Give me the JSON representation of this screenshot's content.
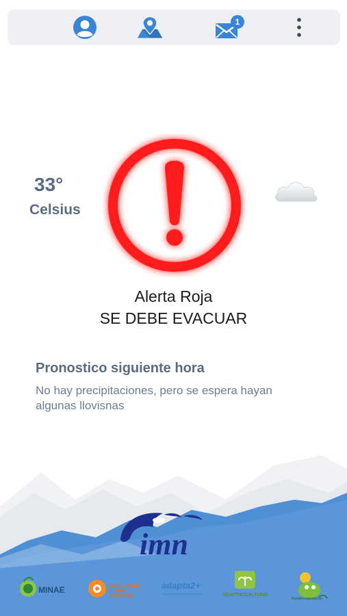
{
  "topbar": {
    "profile_icon": "user-circle-icon",
    "map_icon": "map-pin-icon",
    "messages_icon": "envelope-icon",
    "messages_badge": "1",
    "menu_icon": "more-vert-icon"
  },
  "weather": {
    "temperature": "33°",
    "unit": "Celsius",
    "condition_icon": "cloud-icon"
  },
  "alert": {
    "icon": "exclamation-circle-icon",
    "title": "Alerta Roja",
    "message": "SE DEBE EVACUAR",
    "color": "#ff1a1a"
  },
  "forecast": {
    "heading": "Pronostico siguiente hora",
    "text": "No hay precipitaciones, pero se espera hayan algunas llovisnas"
  },
  "footer": {
    "brand_logo_text": "imn",
    "partners": [
      "MINAE",
      "DIRECCIÓN DE CAMBIO CLIMÁTICO",
      "adapta2+",
      "ADAPTATION FUND",
      "Fundecooperación"
    ],
    "colors": {
      "sky_blue": "#4f8fd4",
      "brand_navy": "#1e2f8f",
      "alert_red": "#ff1a1a"
    }
  }
}
